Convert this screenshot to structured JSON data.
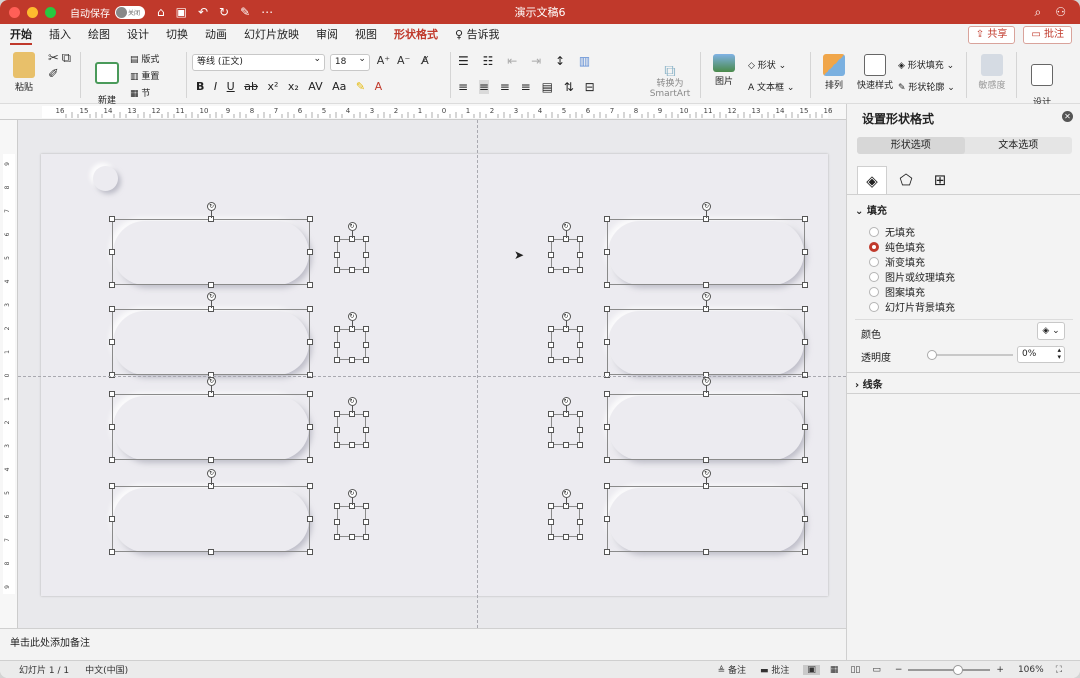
{
  "titlebar": {
    "autosave_label": "自动保存",
    "autosave_state": "关闭",
    "doc_title": "演示文稿6"
  },
  "tabs": [
    "开始",
    "插入",
    "绘图",
    "设计",
    "切换",
    "动画",
    "幻灯片放映",
    "审阅",
    "视图",
    "形状格式",
    "告诉我"
  ],
  "tab_right": {
    "share": "共享",
    "comment": "批注"
  },
  "ribbon": {
    "paste": "粘贴",
    "new_slide": "新建\n幻灯片",
    "layout": "版式",
    "reset": "重置",
    "section": "节",
    "font_name": "等线 (正文)",
    "font_size": "18",
    "convert_smartart": "转换为\nSmartArt",
    "picture": "图片",
    "shape": "形状",
    "textbox": "文本框",
    "arrange": "排列",
    "quick_styles": "快速样式",
    "shape_fill": "形状填充",
    "shape_outline": "形状轮廓",
    "sensitivity": "敏感度",
    "designer": "设计\n灵感"
  },
  "ruler_h": [
    "16",
    "15",
    "14",
    "13",
    "12",
    "11",
    "10",
    "9",
    "8",
    "7",
    "6",
    "5",
    "4",
    "3",
    "2",
    "1",
    "0",
    "1",
    "2",
    "3",
    "4",
    "5",
    "6",
    "7",
    "8",
    "9",
    "10",
    "11",
    "12",
    "13",
    "14",
    "15",
    "16"
  ],
  "ruler_v": [
    "9",
    "8",
    "7",
    "6",
    "5",
    "4",
    "3",
    "2",
    "1",
    "0",
    "1",
    "2",
    "3",
    "4",
    "5",
    "6",
    "7",
    "8",
    "9"
  ],
  "notes_placeholder": "单击此处添加备注",
  "status": {
    "slide_info": "幻灯片 1 / 1",
    "language": "中文(中国)",
    "notes": "备注",
    "comments": "批注",
    "zoom": "106%"
  },
  "panel": {
    "title": "设置形状格式",
    "tab_shape": "形状选项",
    "tab_text": "文本选项",
    "fill_header": "填充",
    "fill_options": [
      "无填充",
      "纯色填充",
      "渐变填充",
      "图片或纹理填充",
      "图案填充",
      "幻灯片背景填充"
    ],
    "fill_selected": 1,
    "color_label": "颜色",
    "transparency_label": "透明度",
    "transparency_value": "0%",
    "line_header": "线条"
  },
  "colors": {
    "accent": "#c0392b",
    "titlebar": "#c0392b"
  }
}
